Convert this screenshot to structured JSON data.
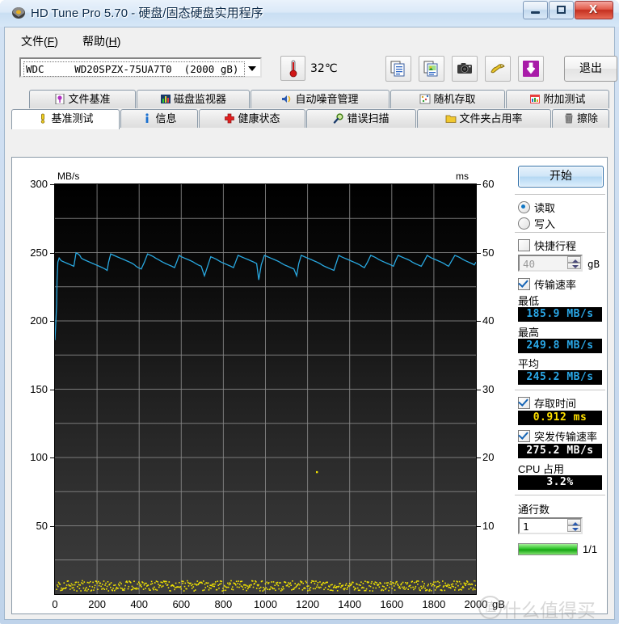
{
  "window": {
    "title": "HD Tune Pro 5.70 - 硬盘/固态硬盘实用程序",
    "icon": "disk-icon",
    "buttons": {
      "minimize": "–",
      "maximize": "□",
      "close": "X"
    }
  },
  "menubar": {
    "items": [
      {
        "name": "file",
        "label": "文件",
        "accel": "F"
      },
      {
        "name": "help",
        "label": "帮助",
        "accel": "H"
      }
    ]
  },
  "toolbar": {
    "drive": "WDC     WD20SPZX-75UA7T0  (2000 gB)",
    "temperature": "32℃",
    "temp_icon": "thermometer-icon",
    "buttons": [
      {
        "name": "copy-text-button",
        "icon": "copy-text-icon"
      },
      {
        "name": "copy-image-button",
        "icon": "copy-image-icon"
      },
      {
        "name": "screenshot-button",
        "icon": "camera-icon"
      },
      {
        "name": "folder-button",
        "icon": "folder-icon"
      },
      {
        "name": "download-button",
        "icon": "down-arrow-icon"
      }
    ],
    "exit_label": "退出"
  },
  "tabs_row1": [
    {
      "label": "文件基准",
      "icon": "file-benchmark-icon",
      "active": false
    },
    {
      "label": "磁盘监视器",
      "icon": "disk-monitor-icon",
      "active": false
    },
    {
      "label": "自动噪音管理",
      "icon": "speaker-icon",
      "active": false
    },
    {
      "label": "随机存取",
      "icon": "random-access-icon",
      "active": false
    },
    {
      "label": "附加测试",
      "icon": "extra-tests-icon",
      "active": false
    }
  ],
  "tabs_row2": [
    {
      "label": "基准测试",
      "icon": "benchmark-icon",
      "active": true
    },
    {
      "label": "信息",
      "icon": "info-icon",
      "active": false
    },
    {
      "label": "健康状态",
      "icon": "health-icon",
      "active": false
    },
    {
      "label": "错误扫描",
      "icon": "error-scan-icon",
      "active": false
    },
    {
      "label": "文件夹占用率",
      "icon": "folder-usage-icon",
      "active": false
    },
    {
      "label": "擦除",
      "icon": "erase-icon",
      "active": false
    }
  ],
  "panel": {
    "start_label": "开始",
    "mode": {
      "read_label": "读取",
      "write_label": "写入",
      "selected": "read"
    },
    "short_stroke": {
      "label": "快捷行程",
      "checked": false,
      "value": "40",
      "unit": "gB"
    },
    "transfer_rate": {
      "label": "传输速率",
      "checked": true
    },
    "minimum": {
      "label": "最低",
      "value": "185.9 MB/s"
    },
    "maximum": {
      "label": "最高",
      "value": "249.8 MB/s"
    },
    "average": {
      "label": "平均",
      "value": "245.2 MB/s"
    },
    "access_time": {
      "label": "存取时间",
      "checked": true,
      "value": "0.912 ms"
    },
    "burst_rate": {
      "label": "突发传输速率",
      "checked": true,
      "value": "275.2 MB/s"
    },
    "cpu_usage": {
      "label": "CPU 占用",
      "value": "3.2%"
    },
    "passes": {
      "label": "通行数",
      "value": "1"
    },
    "progress": {
      "percent": 100,
      "text": "1/1"
    }
  },
  "watermark": {
    "mark": "值",
    "text": "什么值得买"
  },
  "chart_data": {
    "type": "line",
    "title": "",
    "xlabel": "gB",
    "ylabel": "MB/s",
    "y2label": "ms",
    "xlim": [
      0,
      2000
    ],
    "ylim": [
      0,
      300
    ],
    "y2lim": [
      0,
      60
    ],
    "xticks": [
      0,
      200,
      400,
      600,
      800,
      1000,
      1200,
      1400,
      1600,
      1800,
      2000
    ],
    "yticks": [
      50,
      100,
      150,
      200,
      250,
      300
    ],
    "y2ticks": [
      10,
      20,
      30,
      40,
      50,
      60
    ],
    "grid": true,
    "grid_x_step": 200,
    "grid_y_step": 25,
    "series": [
      {
        "name": "transfer-rate",
        "axis": "left",
        "color": "#29a8e0",
        "unit": "MB/s",
        "x": [
          0,
          8,
          10,
          14,
          20,
          30,
          45,
          60,
          75,
          90,
          100,
          110,
          118,
          125,
          135,
          150,
          165,
          180,
          195,
          210,
          225,
          238,
          248,
          255,
          265,
          280,
          295,
          310,
          325,
          340,
          355,
          368,
          378,
          385,
          395,
          410,
          425,
          440,
          455,
          468,
          478,
          490,
          500,
          512,
          525,
          540,
          555,
          568,
          578,
          590,
          600,
          615,
          630,
          645,
          658,
          668,
          680,
          695,
          710,
          725,
          740,
          755,
          768,
          778,
          790,
          805,
          820,
          835,
          848,
          858,
          870,
          885,
          900,
          915,
          930,
          945,
          958,
          968,
          980,
          995,
          1010,
          1025,
          1040,
          1055,
          1068,
          1078,
          1090,
          1105,
          1120,
          1135,
          1148,
          1158,
          1170,
          1185,
          1200,
          1215,
          1230,
          1245,
          1258,
          1268,
          1280,
          1295,
          1310,
          1325,
          1338,
          1348,
          1360,
          1375,
          1390,
          1405,
          1420,
          1435,
          1448,
          1458,
          1470,
          1485,
          1500,
          1515,
          1528,
          1538,
          1550,
          1565,
          1580,
          1595,
          1608,
          1618,
          1630,
          1645,
          1660,
          1675,
          1688,
          1698,
          1710,
          1725,
          1740,
          1755,
          1768,
          1778,
          1790,
          1805,
          1820,
          1835,
          1848,
          1858,
          1870,
          1885,
          1900,
          1915,
          1928,
          1938,
          1950,
          1965,
          1980,
          1992,
          2000
        ],
        "y": [
          185.9,
          212,
          230,
          243,
          246,
          244,
          243,
          242,
          241,
          240,
          249.8,
          249,
          248,
          246,
          245,
          244,
          243,
          242,
          241,
          240,
          239,
          238,
          237,
          243,
          249,
          248,
          247,
          246,
          245,
          244,
          243,
          242,
          241,
          240,
          239,
          238,
          243,
          249,
          248,
          247,
          246,
          245,
          244,
          243,
          242,
          241,
          240,
          239,
          243,
          248,
          247,
          246,
          245,
          244,
          243,
          242,
          241,
          240,
          233,
          240,
          247,
          246,
          245,
          244,
          243,
          242,
          241,
          240,
          239,
          243,
          248,
          247,
          246,
          245,
          244,
          243,
          242,
          230,
          241,
          248,
          247,
          246,
          245,
          244,
          243,
          242,
          241,
          240,
          239,
          238,
          233,
          242,
          248,
          247,
          246,
          245,
          244,
          243,
          242,
          241,
          240,
          239,
          238,
          237,
          243,
          248,
          247,
          246,
          245,
          244,
          243,
          242,
          241,
          240,
          239,
          243,
          248,
          247,
          246,
          245,
          244,
          243,
          242,
          241,
          240,
          244,
          248,
          247,
          246,
          245,
          244,
          243,
          242,
          241,
          240,
          244,
          248,
          247,
          246,
          245,
          244,
          243,
          242,
          241,
          240,
          244,
          248,
          247,
          246,
          245,
          244,
          243,
          242,
          241,
          243,
          247,
          246,
          245
        ]
      },
      {
        "name": "access-time",
        "axis": "right",
        "color": "#f2e400",
        "unit": "ms",
        "mean": 0.912,
        "note": "scatter of access-time samples near 1 ms along the bottom, with one outlier near 18 ms at ~1240 gB"
      }
    ]
  }
}
